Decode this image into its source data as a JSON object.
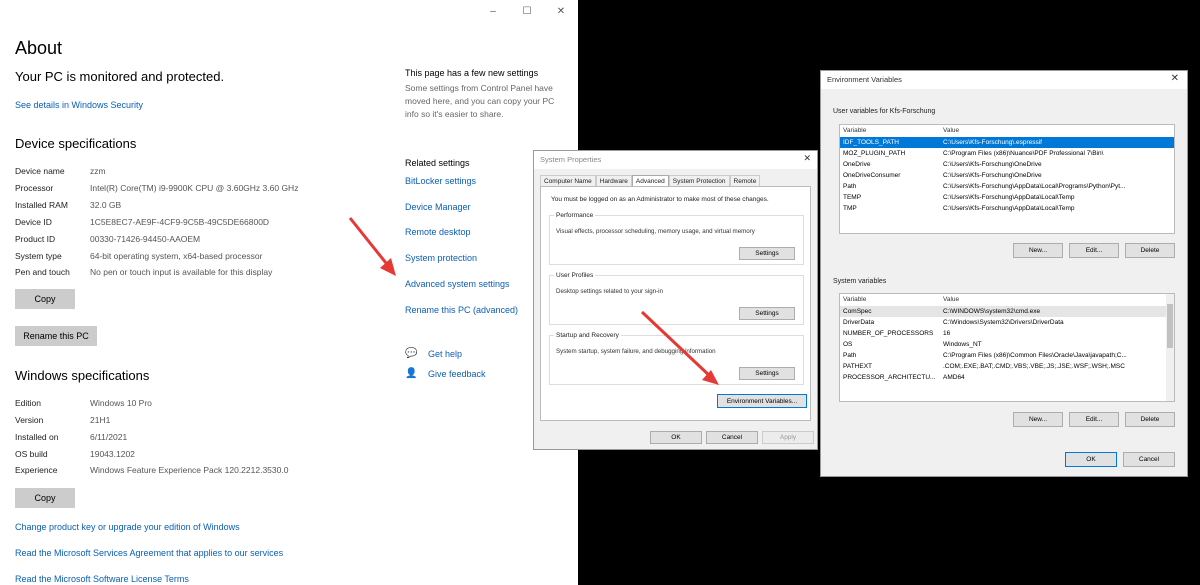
{
  "about": {
    "window_controls": [
      "–",
      "☐",
      "✕"
    ],
    "title": "About",
    "protected": "Your PC is monitored and protected.",
    "security_link": "See details in Windows Security",
    "device_specs_heading": "Device specifications",
    "device_specs": [
      {
        "k": "Device name",
        "v": "zzm"
      },
      {
        "k": "Processor",
        "v": "Intel(R) Core(TM) i9-9900K CPU @ 3.60GHz   3.60 GHz"
      },
      {
        "k": "Installed RAM",
        "v": "32.0 GB"
      },
      {
        "k": "Device ID",
        "v": "1C5E8EC7-AE9F-4CF9-9C5B-49C5DE66800D"
      },
      {
        "k": "Product ID",
        "v": "00330-71426-94450-AAOEM"
      },
      {
        "k": "System type",
        "v": "64-bit operating system, x64-based processor"
      },
      {
        "k": "Pen and touch",
        "v": "No pen or touch input is available for this display"
      }
    ],
    "copy_label": "Copy",
    "rename_label": "Rename this PC",
    "windows_specs_heading": "Windows specifications",
    "windows_specs": [
      {
        "k": "Edition",
        "v": "Windows 10 Pro"
      },
      {
        "k": "Version",
        "v": "21H1"
      },
      {
        "k": "Installed on",
        "v": "6/11/2021"
      },
      {
        "k": "OS build",
        "v": "19043.1202"
      },
      {
        "k": "Experience",
        "v": "Windows Feature Experience Pack 120.2212.3530.0"
      }
    ],
    "copy2_label": "Copy",
    "links": [
      "Change product key or upgrade your edition of Windows",
      "Read the Microsoft Services Agreement that applies to our services",
      "Read the Microsoft Software License Terms"
    ],
    "side": {
      "new_settings_heading": "This page has a few new settings",
      "new_settings_text": "Some settings from Control Panel have moved here, and you can copy your PC info so it's easier to share.",
      "related_heading": "Related settings",
      "related_links": [
        "BitLocker settings",
        "Device Manager",
        "Remote desktop",
        "System protection",
        "Advanced system settings",
        "Rename this PC (advanced)"
      ],
      "help": "Get help",
      "feedback": "Give feedback"
    }
  },
  "sysprop": {
    "title": "System Properties",
    "close": "✕",
    "tabs": [
      "Computer Name",
      "Hardware",
      "Advanced",
      "System Protection",
      "Remote"
    ],
    "active_tab": "Advanced",
    "admin_note": "You must be logged on as an Administrator to make most of these changes.",
    "performance": {
      "label": "Performance",
      "text": "Visual effects, processor scheduling, memory usage, and virtual memory",
      "button": "Settings"
    },
    "profiles": {
      "label": "User Profiles",
      "text": "Desktop settings related to your sign-in",
      "button": "Settings"
    },
    "startup": {
      "label": "Startup and Recovery",
      "text": "System startup, system failure, and debugging information",
      "button": "Settings"
    },
    "env_button": "Environment Variables...",
    "ok": "OK",
    "cancel": "Cancel",
    "apply": "Apply"
  },
  "envvar": {
    "title": "Environment Variables",
    "close": "✕",
    "user_label": "User variables for Kfs-Forschung",
    "col_variable": "Variable",
    "col_value": "Value",
    "user_vars": [
      {
        "n": "IDF_TOOLS_PATH",
        "v": "C:\\Users\\Kfs-Forschung\\.espressif"
      },
      {
        "n": "MOZ_PLUGIN_PATH",
        "v": "C:\\Program Files (x86)\\Nuance\\PDF Professional 7\\Bin\\"
      },
      {
        "n": "OneDrive",
        "v": "C:\\Users\\Kfs-Forschung\\OneDrive"
      },
      {
        "n": "OneDriveConsumer",
        "v": "C:\\Users\\Kfs-Forschung\\OneDrive"
      },
      {
        "n": "Path",
        "v": "C:\\Users\\Kfs-Forschung\\AppData\\Local\\Programs\\Python\\Pyt..."
      },
      {
        "n": "TEMP",
        "v": "C:\\Users\\Kfs-Forschung\\AppData\\Local\\Temp"
      },
      {
        "n": "TMP",
        "v": "C:\\Users\\Kfs-Forschung\\AppData\\Local\\Temp"
      }
    ],
    "system_label": "System variables",
    "system_vars": [
      {
        "n": "ComSpec",
        "v": "C:\\WINDOWS\\system32\\cmd.exe"
      },
      {
        "n": "DriverData",
        "v": "C:\\Windows\\System32\\Drivers\\DriverData"
      },
      {
        "n": "NUMBER_OF_PROCESSORS",
        "v": "16"
      },
      {
        "n": "OS",
        "v": "Windows_NT"
      },
      {
        "n": "Path",
        "v": "C:\\Program Files (x86)\\Common Files\\Oracle\\Java\\javapath;C..."
      },
      {
        "n": "PATHEXT",
        "v": ".COM;.EXE;.BAT;.CMD;.VBS;.VBE;.JS;.JSE;.WSF;.WSH;.MSC"
      },
      {
        "n": "PROCESSOR_ARCHITECTU...",
        "v": "AMD64"
      }
    ],
    "new": "New...",
    "edit": "Edit...",
    "delete": "Delete",
    "ok": "OK",
    "cancel": "Cancel"
  },
  "colors": {
    "accent": "#0078d7",
    "link": "#0a5fb4",
    "arrow": "#e53935"
  }
}
